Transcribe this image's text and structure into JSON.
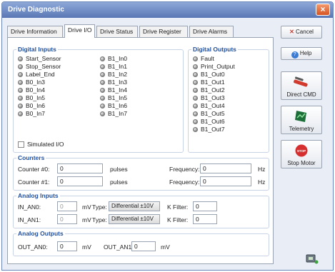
{
  "window": {
    "title": "Drive Diagnostic"
  },
  "tabs": [
    "Drive Information",
    "Drive I/O",
    "Drive Status",
    "Drive Register",
    "Drive Alarms"
  ],
  "active_tab": "Drive I/O",
  "digital_inputs": {
    "title": "Digital Inputs",
    "left": [
      "Start_Sensor",
      "Stop_Sensor",
      "Label_End",
      "B0_In3",
      "B0_In4",
      "B0_In5",
      "B0_In6",
      "B0_In7"
    ],
    "right": [
      "B1_In0",
      "B1_In1",
      "B1_In2",
      "B1_In3",
      "B1_In4",
      "B1_In5",
      "B1_In6",
      "B1_In7"
    ],
    "simulated_label": "Simulated I/O",
    "simulated_checked": false
  },
  "digital_outputs": {
    "title": "Digital Outputs",
    "items": [
      "Fault",
      "Print_Output",
      "B1_Out0",
      "B1_Out1",
      "B1_Out2",
      "B1_Out3",
      "B1_Out4",
      "B1_Out5",
      "B1_Out6",
      "B1_Out7"
    ]
  },
  "counters": {
    "title": "Counters",
    "rows": [
      {
        "label": "Counter #0:",
        "value": "0",
        "unit": "pulses",
        "freq_label": "Frequency:",
        "freq_value": "0",
        "freq_unit": "Hz"
      },
      {
        "label": "Counter #1:",
        "value": "0",
        "unit": "pulses",
        "freq_label": "Frequency:",
        "freq_value": "0",
        "freq_unit": "Hz"
      }
    ]
  },
  "analog_inputs": {
    "title": "Analog Inputs",
    "rows": [
      {
        "label": "IN_AN0:",
        "value": "0",
        "unit": "mV",
        "type_label": "Type:",
        "type_value": "Differential ±10V",
        "kfilter_label": "K Filter:",
        "kfilter_value": "0"
      },
      {
        "label": "IN_AN1:",
        "value": "0",
        "unit": "mV",
        "type_label": "Type:",
        "type_value": "Differential ±10V",
        "kfilter_label": "K Filter:",
        "kfilter_value": "0"
      }
    ]
  },
  "analog_outputs": {
    "title": "Analog Outputs",
    "an0_label": "OUT_AN0:",
    "an0_value": "0",
    "an0_unit": "mV",
    "an1_label": "OUT_AN1:",
    "an1_value": "0",
    "an1_unit": "mV"
  },
  "buttons": {
    "cancel": "Cancel",
    "help": "Help",
    "direct_cmd": "Direct CMD",
    "telemetry": "Telemetry",
    "stop_motor": "Stop Motor",
    "stop_icon_text": "STOP"
  },
  "icons": {
    "cancel": "close-x-icon",
    "help": "help-icon",
    "direct_cmd": "direct-command-icon",
    "telemetry": "telemetry-icon",
    "stop_motor": "stop-sign-icon",
    "connection": "connection-status-icon"
  },
  "colors": {
    "title_bar": "#5977b5",
    "group_title": "#1f4f9e",
    "close_button": "#d55423",
    "stop": "#d62f2f"
  }
}
